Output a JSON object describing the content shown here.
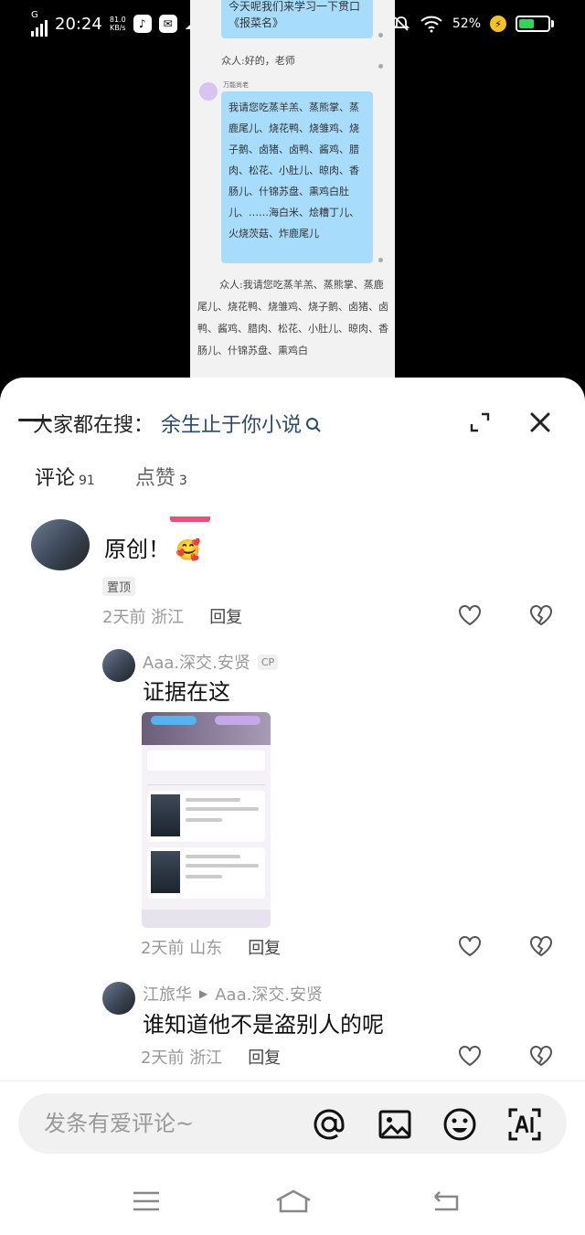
{
  "status_bar": {
    "network": "G",
    "time": "20:24",
    "speed_value": "81.0",
    "speed_unit": "KB/s",
    "battery_percent": "52%",
    "battery_level": 0.52,
    "icons": [
      "tiktok-icon",
      "mail-icon",
      "cloud-icon",
      "mute-icon",
      "wifi-icon",
      "charging-icon"
    ]
  },
  "novel": {
    "bubble1": "今天呢我们来学习一下贯口《报菜名》",
    "line1": "众人:好的，老师",
    "speaker": "万能尚老",
    "bubble2": "我请您吃蒸羊羔、蒸熊掌、蒸鹿尾儿、烧花鸭、烧雏鸡、烧子鹅、卤猪、卤鸭、酱鸡、腊肉、松花、小肚儿、晾肉、香肠儿、什锦苏盘、熏鸡白肚儿、……海白米、烩糟丁儿、火烧茨菇、炸鹿尾儿",
    "para": "众人:我请您吃蒸羊羔、蒸熊掌、蒸鹿尾儿、烧花鸭、烧雏鸡、烧子鹅、卤猪、卤鸭、酱鸡、腊肉、松花、小肚儿、晾肉、香肠儿、什锦苏盘、熏鸡白"
  },
  "sheet": {
    "search_prefix": "大家都在搜：",
    "search_term": "余生止于你小说",
    "tabs": [
      {
        "label": "评论",
        "count": "91"
      },
      {
        "label": "点赞",
        "count": "3"
      }
    ]
  },
  "comments": [
    {
      "text": "原创！",
      "emoji": "🥰",
      "pinned": "置顶",
      "time": "2天前",
      "location": "浙江",
      "reply": "回复"
    },
    {
      "author": "Aaa.深交.安贤",
      "badge": "CP",
      "text": "证据在这",
      "time": "2天前",
      "location": "山东",
      "reply": "回复"
    },
    {
      "author": "江旅华",
      "reply_to": "Aaa.深交.安贤",
      "text": "谁知道他不是盗别人的呢",
      "time": "2天前",
      "location": "浙江",
      "reply": "回复"
    }
  ],
  "input": {
    "placeholder": "发条有爱评论~"
  }
}
